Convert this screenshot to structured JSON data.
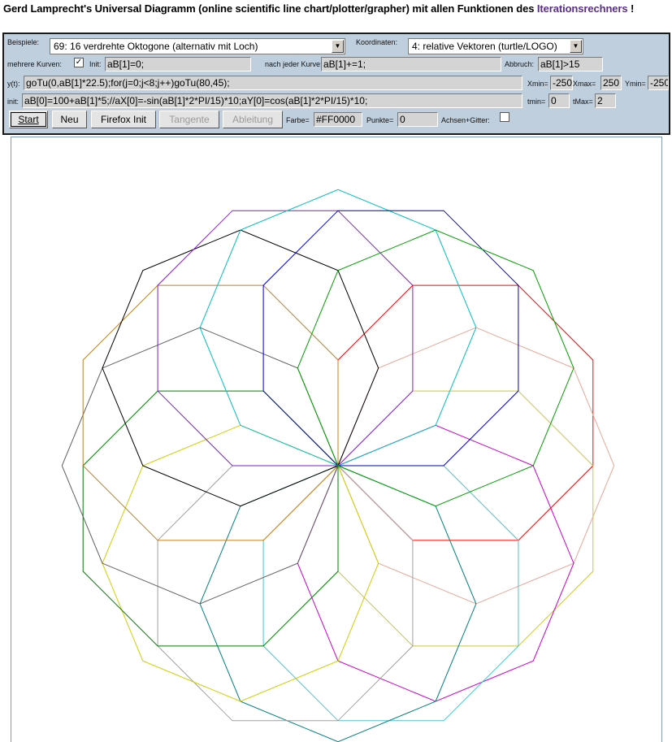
{
  "title": {
    "text": "Gerd Lamprecht's Universal Diagramm (online scientific line chart/plotter/grapher) mit allen Funktionen des ",
    "link": "Iterationsrechners",
    "suffix": " !"
  },
  "controls": {
    "beispiele_label": "Beispiele:",
    "beispiele_value": "69: 16 verdrehte Oktogone (alternativ mit Loch)",
    "koordinaten_label": "Koordinaten:",
    "koordinaten_value": "4: relative Vektoren (turtle/LOGO)",
    "mehrere_label": "mehrere Kurven:",
    "mehrere_checked": "✓",
    "init_label": "Init:",
    "init_value": "aB[1]=0;",
    "nach_label": "nach jeder Kurve:",
    "nach_value": "aB[1]+=1;",
    "abbruch_label": "Abbruch:",
    "abbruch_value": "aB[1]>15",
    "yt_label": "y(t):",
    "yt_value": "goTu(0,aB[1]*22.5);for(j=0;j<8;j++)goTu(80,45);",
    "xmin_label": "Xmin=",
    "xmin_value": "-250",
    "xmax_label": "Xmax=",
    "xmax_value": "250",
    "ymin_label": "Ymin=",
    "ymin_value": "-250",
    "init2_label": "init:",
    "init2_value": "aB[0]=100+aB[1]*5;//aX[0]=-sin(aB[1]*2*PI/15)*10;aY[0]=cos(aB[1]*2*PI/15)*10;",
    "tmin_label": "tmin=",
    "tmin_value": "0",
    "tmax_label": "tMax=",
    "tmax_value": "2",
    "start_label": "Start",
    "neu_label": "Neu",
    "firefox_label": "Firefox Init",
    "tangente_label": "Tangente",
    "ableitung_label": "Ableitung",
    "farbe_label": "Farbe=",
    "farbe_value": "#FF0000",
    "punkte_label": "Punkte=",
    "punkte_value": "0",
    "achsen_label": "Achsen+Gitter:"
  },
  "plot": {
    "octagon_count": 16,
    "octagon_side": 80,
    "rotation_step_deg": 22.5,
    "turn_deg": 45,
    "colors": [
      "#ff0000",
      "#e8a898",
      "#c8c840",
      "#cc00cc",
      "#40c8d8",
      "#008080",
      "#a0a0a0",
      "#d0d000",
      "#008000",
      "#606060",
      "#c08020",
      "#000000",
      "#8020c0",
      "#00c0c0",
      "#0000c0",
      "#00a000"
    ]
  }
}
